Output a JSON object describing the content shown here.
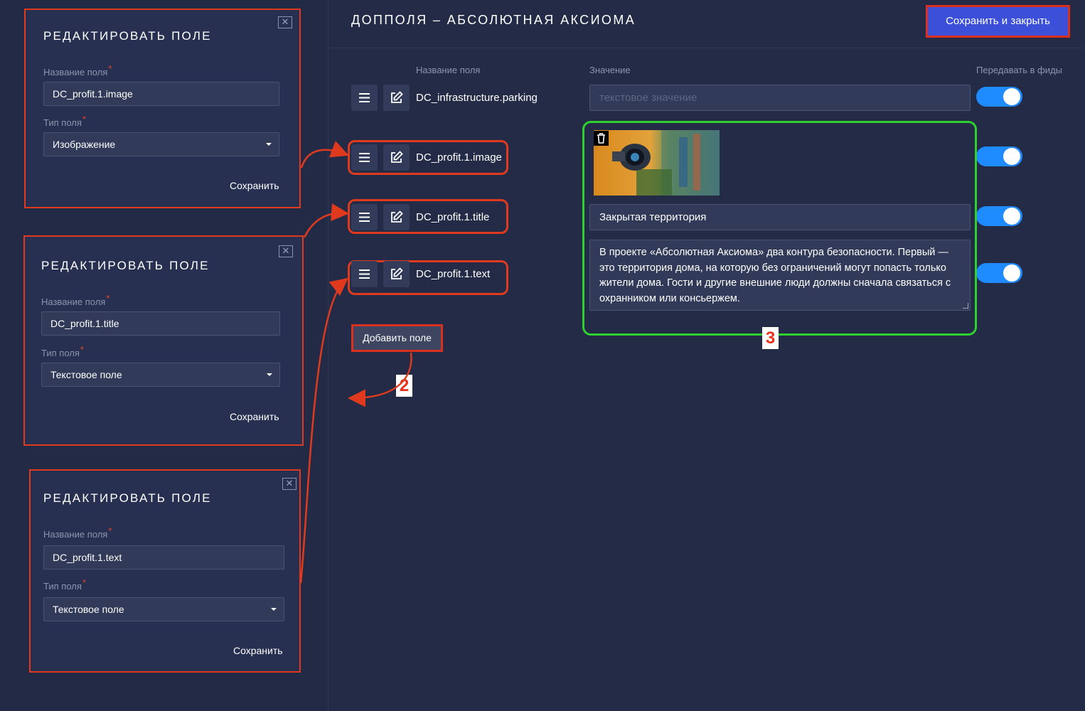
{
  "header": {
    "title": "ДОППОЛЯ – АБСОЛЮТНАЯ АКСИОМА",
    "save_close_label": "Сохранить и закрыть"
  },
  "table": {
    "col_name": "Название поля",
    "col_value": "Значение",
    "col_feeds": "Передавать в фиды",
    "rows": [
      {
        "name": "DC_infrastructure.parking",
        "value_placeholder": "текстовое значение",
        "feed": true
      },
      {
        "name": "DC_profit.1.image",
        "value": "image",
        "feed": true
      },
      {
        "name": "DC_profit.1.title",
        "value": "Закрытая территория",
        "feed": true
      },
      {
        "name": "DC_profit.1.text",
        "value": "В проекте «Абсолютная Аксиома» два контура безопасности. Первый — это территория дома, на которую без ограничений могут попасть только жители дома. Гости и другие внешние люди должны сначала связаться с охранником или консьержем.",
        "feed": true
      }
    ],
    "add_field_label": "Добавить поле"
  },
  "modals": [
    {
      "title": "РЕДАКТИРОВАТЬ ПОЛЕ",
      "name_label": "Название поля",
      "name_value": "DC_profit.1.image",
      "type_label": "Тип поля",
      "type_value": "Изображение",
      "save_label": "Сохранить"
    },
    {
      "title": "РЕДАКТИРОВАТЬ ПОЛЕ",
      "name_label": "Название поля",
      "name_value": "DC_profit.1.title",
      "type_label": "Тип поля",
      "type_value": "Текстовое поле",
      "save_label": "Сохранить"
    },
    {
      "title": "РЕДАКТИРОВАТЬ ПОЛЕ",
      "name_label": "Название поля",
      "name_value": "DC_profit.1.text",
      "type_label": "Тип поля",
      "type_value": "Текстовое поле",
      "save_label": "Сохранить"
    }
  ],
  "annotations": {
    "badge_2": "2",
    "badge_3": "3"
  },
  "icons": {
    "close": "close-icon",
    "drag": "drag-handle-icon",
    "edit": "edit-icon",
    "trash": "trash-icon",
    "caret": "chevron-down-icon"
  },
  "colors": {
    "background": "#242b47",
    "accent_blue": "#3c4fd9",
    "toggle_on": "#1e8bff",
    "annotation_red": "#e03a1e",
    "annotation_green": "#2fd12e"
  }
}
